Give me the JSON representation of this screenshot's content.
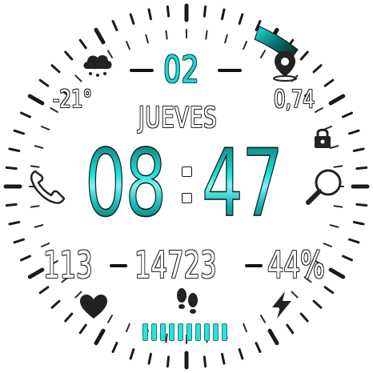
{
  "watchface": {
    "day_of_month": "02",
    "weekday": "JUEVES",
    "temperature": "-21°",
    "location_value": "0,74",
    "time": {
      "hours": "08",
      "minutes": "47"
    },
    "stats": {
      "left": "113",
      "middle": "14723",
      "right": "44%"
    },
    "step_progress_bars": 10
  },
  "colors": {
    "accent": "#1fd7d3",
    "accent_dark": "#0b4d4b",
    "outline": "#111111",
    "background": "#ffffff"
  },
  "icons": {
    "weather": "cloud-snow-icon",
    "location": "map-pin-icon",
    "lock": "lock-icon",
    "phone": "phone-icon",
    "search": "search-icon",
    "heart": "heart-icon",
    "steps": "footprints-icon",
    "battery": "lightning-icon"
  }
}
